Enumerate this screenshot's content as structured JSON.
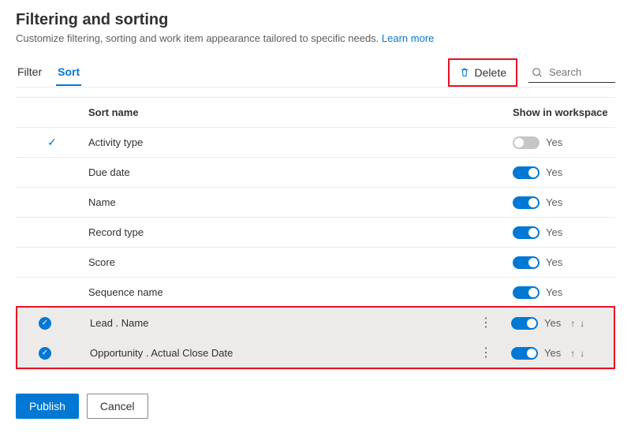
{
  "header": {
    "title": "Filtering and sorting",
    "subtitle_prefix": "Customize filtering, sorting and work item appearance tailored to specific needs. ",
    "learn_more": "Learn more"
  },
  "tabs": {
    "filter": "Filter",
    "sort": "Sort"
  },
  "toolbar": {
    "delete_label": "Delete",
    "search_placeholder": "Search"
  },
  "columns": {
    "sort_name": "Sort name",
    "show_in_workspace": "Show in workspace"
  },
  "rows": [
    {
      "name": "Activity type",
      "check": true,
      "toggle_on": false,
      "toggle_label": "Yes",
      "selected": false
    },
    {
      "name": "Due date",
      "check": false,
      "toggle_on": true,
      "toggle_label": "Yes",
      "selected": false
    },
    {
      "name": "Name",
      "check": false,
      "toggle_on": true,
      "toggle_label": "Yes",
      "selected": false
    },
    {
      "name": "Record type",
      "check": false,
      "toggle_on": true,
      "toggle_label": "Yes",
      "selected": false
    },
    {
      "name": "Score",
      "check": false,
      "toggle_on": true,
      "toggle_label": "Yes",
      "selected": false
    },
    {
      "name": "Sequence name",
      "check": false,
      "toggle_on": true,
      "toggle_label": "Yes",
      "selected": false
    },
    {
      "name": "Lead . Name",
      "check": false,
      "toggle_on": true,
      "toggle_label": "Yes",
      "selected": true
    },
    {
      "name": "Opportunity . Actual Close Date",
      "check": false,
      "toggle_on": true,
      "toggle_label": "Yes",
      "selected": true
    }
  ],
  "footer": {
    "publish": "Publish",
    "cancel": "Cancel"
  }
}
